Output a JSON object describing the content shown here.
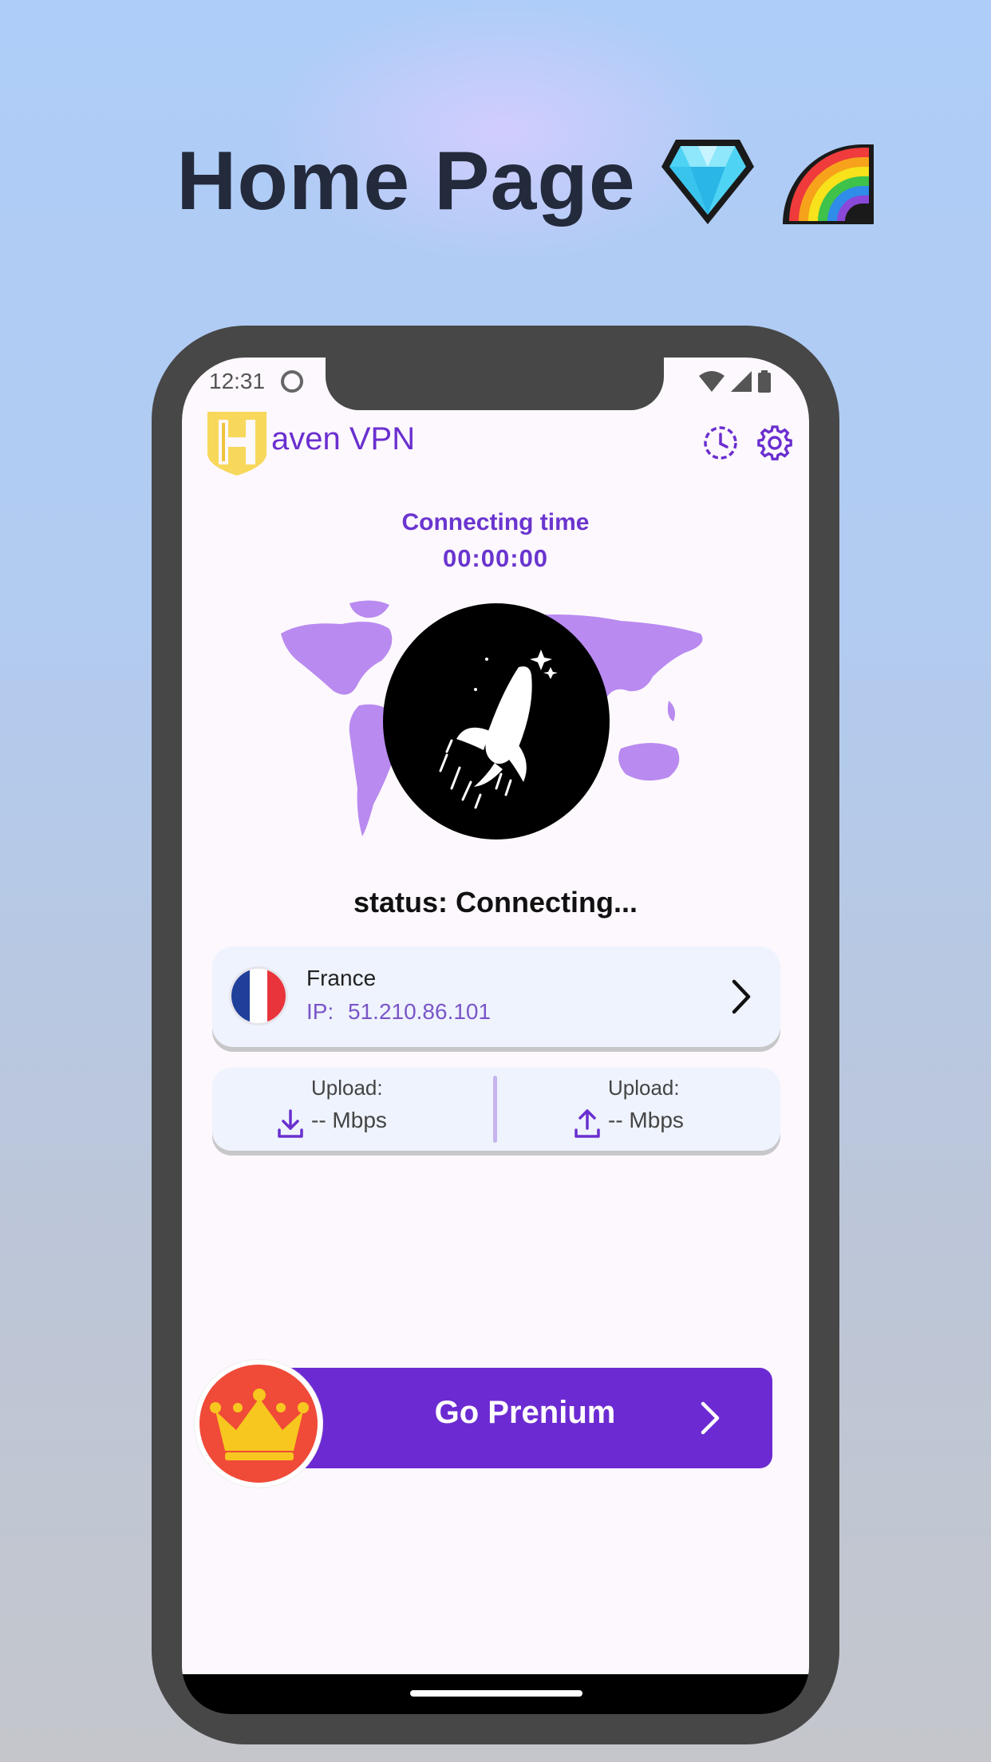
{
  "headline": {
    "title": "Home Page",
    "emojis": [
      "gem-stone",
      "rainbow"
    ]
  },
  "status_bar": {
    "time": "12:31",
    "icons": [
      "cat-face-icon",
      "wifi-icon",
      "cellular-icon",
      "battery-icon"
    ]
  },
  "app_bar": {
    "brand_name": "aven VPN",
    "logo_letter": "H",
    "actions": [
      "history-icon",
      "settings-icon"
    ]
  },
  "timer": {
    "label": "Connecting time",
    "value": "00:00:00"
  },
  "connection": {
    "status": "status: Connecting..."
  },
  "server": {
    "country": "France",
    "ip_label": "IP:",
    "ip_value": "51.210.86.101",
    "flag_colors": [
      "#1f3f9a",
      "#ffffff",
      "#e8343a"
    ]
  },
  "speeds": {
    "download": {
      "label": "Upload:",
      "value": "-- Mbps"
    },
    "upload": {
      "label": "Upload:",
      "value": "-- Mbps"
    }
  },
  "premium": {
    "label": "Go Prenium"
  },
  "colors": {
    "accent": "#6c2bd2",
    "accent_text": "#6a35cf",
    "map": "#b98af0",
    "crown_badge": "#f04a38",
    "crown": "#f7c71f",
    "logo": "#f7d85a"
  }
}
